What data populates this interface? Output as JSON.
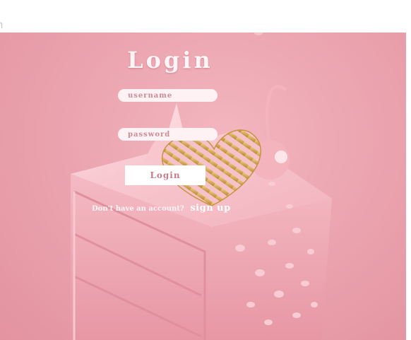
{
  "top_bar": {
    "partial_text": "n"
  },
  "login": {
    "title": "Login",
    "username_placeholder": "username",
    "password_placeholder": "password",
    "submit_label": "Login",
    "signup_prompt": "Don't have an account?",
    "signup_link": "sign up"
  },
  "colors": {
    "background": "#eaa2ad",
    "field_bg": "#fff2f4",
    "button_bg": "#ffffff",
    "button_text": "#c77d8b",
    "heart_gold": "#d8a548"
  }
}
